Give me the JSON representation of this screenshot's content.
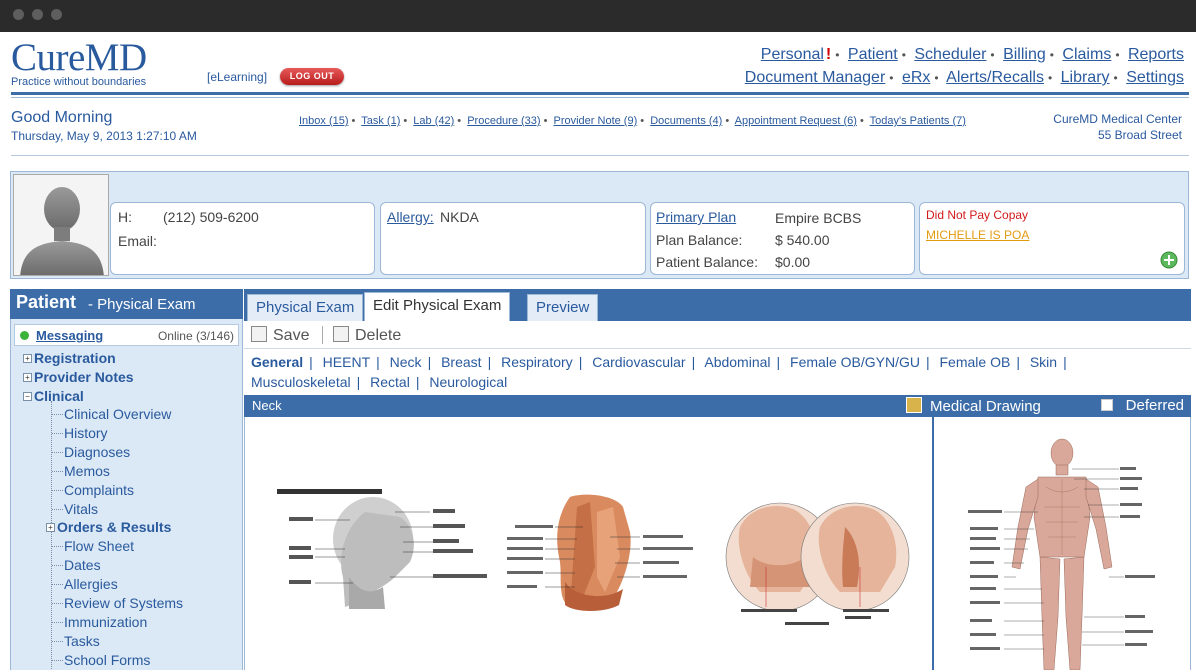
{
  "header": {
    "logo": "CureMD",
    "tagline": "Practice without boundaries",
    "elearning": "[eLearning]",
    "logout": "LOG OUT",
    "nav_row1": [
      "Personal",
      "Patient",
      "Scheduler",
      "Billing",
      "Claims",
      "Reports"
    ],
    "nav_row1_alert": "!",
    "nav_row2": [
      "Document Manager",
      "eRx",
      "Alerts/Recalls",
      "Library",
      "Settings"
    ]
  },
  "greeting": {
    "text": "Good Morning",
    "datetime": "Thursday, May 9, 2013 1:27:10 AM"
  },
  "quicklinks": [
    "Inbox (15)",
    "Task (1)",
    "Lab (42)",
    "Procedure (33)",
    "Provider Note (9)",
    "Documents (4)",
    "Appointment Request (6)",
    "Today's Patients (7)"
  ],
  "center": {
    "name": "CureMD Medical Center",
    "address": "55 Broad Street"
  },
  "patient_banner": {
    "contact": {
      "home_label": "H:",
      "home_value": "(212) 509-6200",
      "email_label": "Email:"
    },
    "allergy": {
      "label": "Allergy:",
      "value": "NKDA"
    },
    "plan": {
      "label": "Primary Plan",
      "value": "Empire BCBS",
      "plan_balance_label": "Plan Balance:",
      "plan_balance_value": "$ 540.00",
      "patient_balance_label": "Patient Balance:",
      "patient_balance_value": "$0.00"
    },
    "alerts": {
      "alert1": "Did Not Pay Copay",
      "alert2": "MICHELLE IS POA"
    },
    "colors": {
      "alert_red": "#d11a1a",
      "alert_orange": "#e39a10"
    }
  },
  "left": {
    "title": "Patient",
    "subtitle": "- Physical Exam",
    "messaging": "Messaging",
    "online": "Online (3/146)",
    "tree": {
      "registration": "Registration",
      "provider_notes": "Provider Notes",
      "clinical": "Clinical",
      "clinical_items": [
        "Clinical Overview",
        "History",
        "Diagnoses",
        "Memos",
        "Complaints",
        "Vitals"
      ],
      "orders_results": "Orders & Results",
      "more_items": [
        "Flow Sheet",
        "Dates",
        "Allergies",
        "Review of Systems",
        "Immunization",
        "Tasks",
        "School Forms"
      ]
    }
  },
  "tabs": [
    "Physical Exam",
    "Edit Physical Exam",
    "Preview"
  ],
  "toolbar": {
    "save": "Save",
    "delete": "Delete"
  },
  "sections_row1": [
    "General",
    "HEENT",
    "Neck",
    "Breast",
    "Respiratory",
    "Cardiovascular",
    "Abdominal",
    "Female OB/GYN/GU",
    "Female OB",
    "Skin"
  ],
  "sections_row2": [
    "Musculoskeletal",
    "Rectal",
    "Neurological"
  ],
  "section_bar": {
    "name": "Neck",
    "medical_drawing": "Medical Drawing",
    "deferred": "Deferred"
  },
  "accent": "#3c6da8"
}
